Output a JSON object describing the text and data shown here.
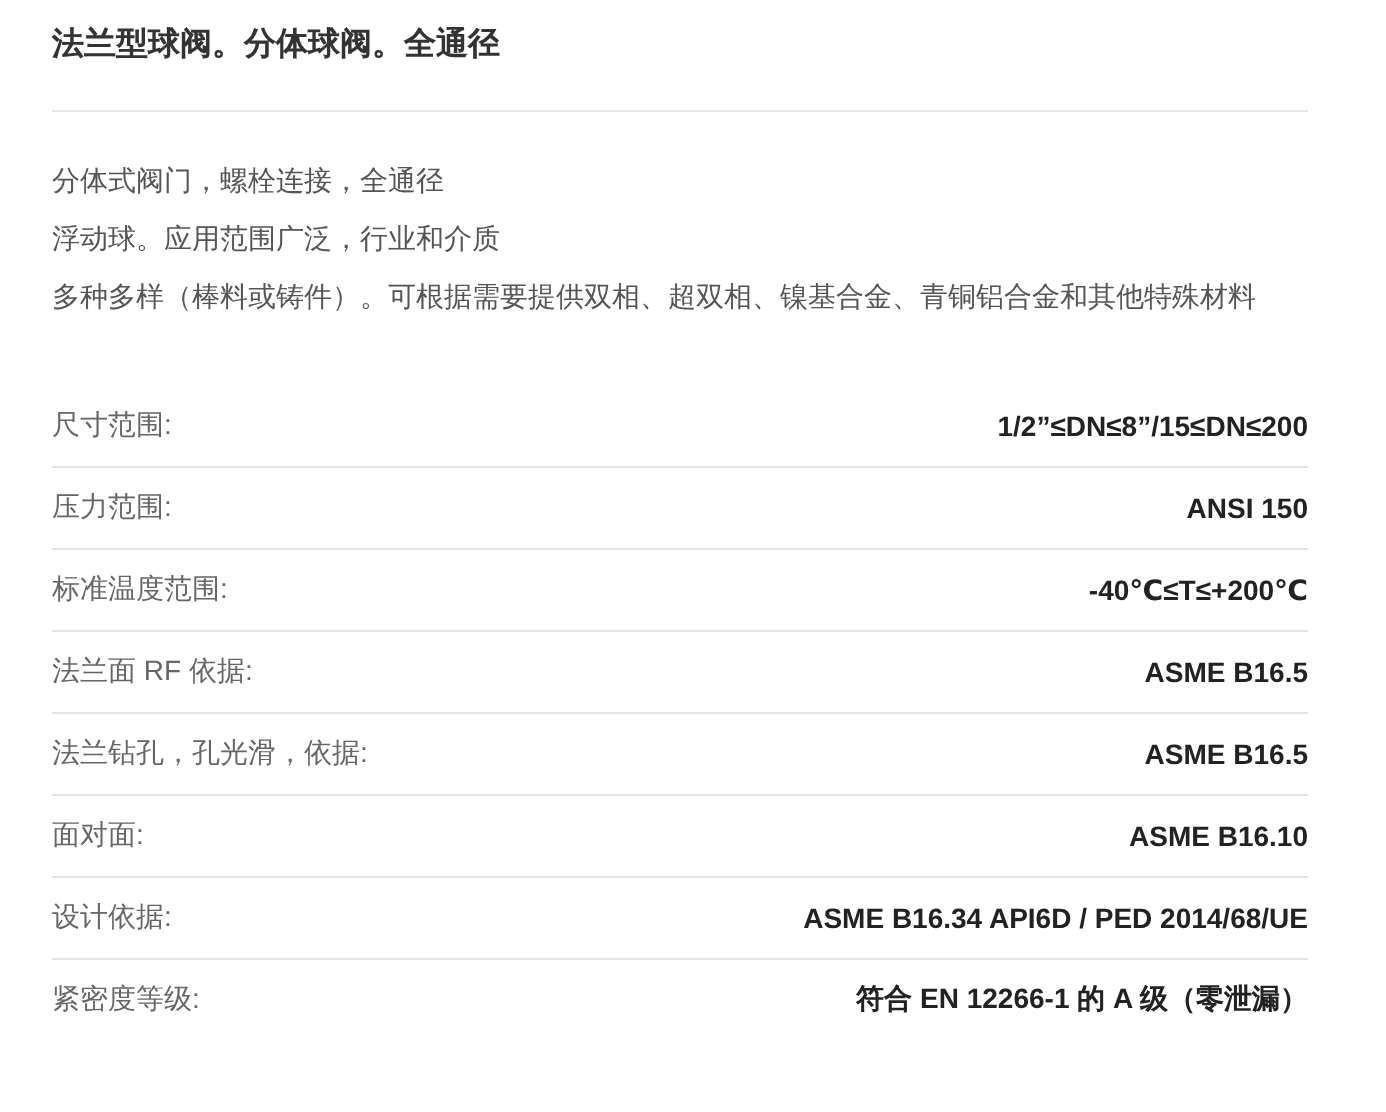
{
  "title": "法兰型球阀。分体球阀。全通径",
  "description": [
    "分体式阀门，螺栓连接，全通径",
    "浮动球。应用范围广泛，行业和介质",
    "多种多样（棒料或铸件）。可根据需要提供双相、超双相、镍基合金、青铜铝合金和其他特殊材料"
  ],
  "specs": [
    {
      "label": "尺寸范围:",
      "value": "1/2”≤DN≤8”/15≤DN≤200"
    },
    {
      "label": "压力范围:",
      "value": "ANSI 150"
    },
    {
      "label": "标准温度范围:",
      "value": "-40℃≤T≤+200℃"
    },
    {
      "label": "法兰面 RF 依据:",
      "value": "ASME B16.5"
    },
    {
      "label": "法兰钻孔，孔光滑，依据:",
      "value": "ASME B16.5"
    },
    {
      "label": "面对面:",
      "value": "ASME B16.10"
    },
    {
      "label": "设计依据:",
      "value": "ASME B16.34 API6D / PED 2014/68/UE"
    },
    {
      "label": "紧密度等级:",
      "value": "符合 EN 12266-1 的 A 级（零泄漏）"
    }
  ]
}
